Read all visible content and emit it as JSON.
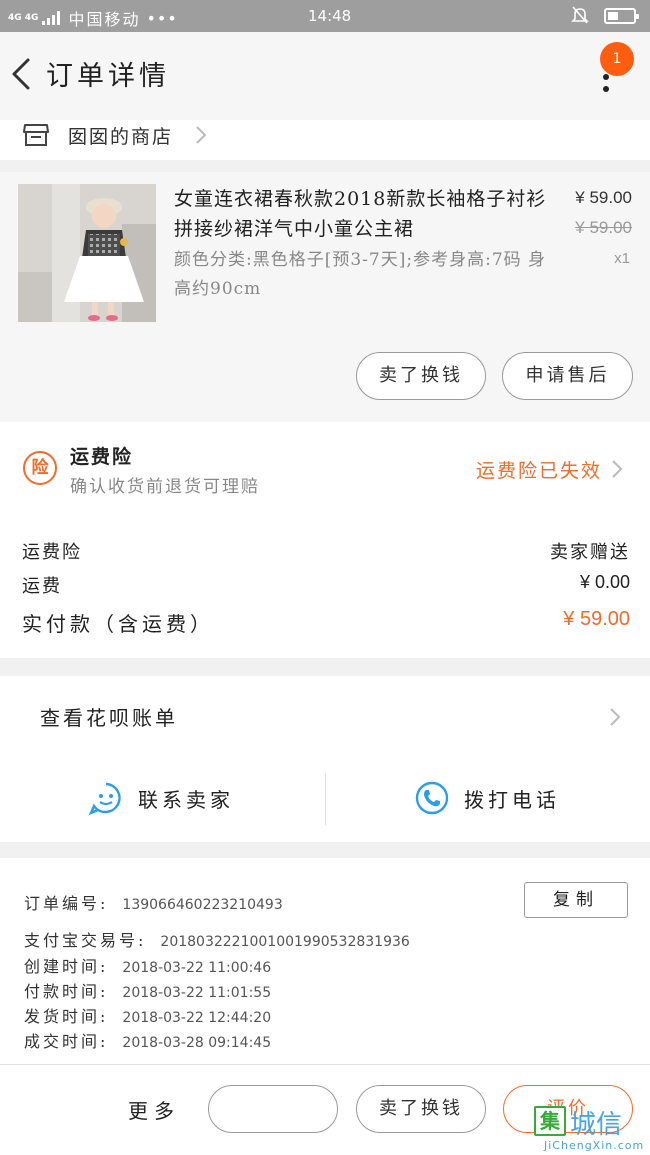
{
  "status_bar": {
    "signal": "4G 4G",
    "carrier": "中国移动",
    "dots": "•••",
    "time": "14:48",
    "icons": [
      "signal-bars-icon",
      "mute-bell-icon",
      "battery-icon"
    ]
  },
  "nav": {
    "title": "订单详情",
    "badge_count": "1",
    "icons": [
      "back-arrow-icon",
      "more-dots-icon"
    ]
  },
  "shop": {
    "name": "囡囡的商店",
    "icons": [
      "shop-icon",
      "chevron-right-icon"
    ]
  },
  "product": {
    "title": "女童连衣裙春秋款2018新款长袖格子衬衫拼接纱裙洋气中小童公主裙",
    "spec": "颜色分类:黑色格子[预3-7天];参考身高:7码 身高约90cm",
    "price": "¥ 59.00",
    "original_price": "¥ 59.00",
    "quantity": "x1",
    "buttons": [
      "卖了换钱",
      "申请售后"
    ]
  },
  "freight": {
    "title": "运费险",
    "subtitle": "确认收货前退货可理赔",
    "status": "运费险已失效",
    "status_color": "#f26b28",
    "rows": [
      {
        "label": "运费险",
        "value": "卖家赠送"
      },
      {
        "label": "运费",
        "value": "¥ 0.00"
      },
      {
        "label": "实付款（含运费）",
        "value": "¥ 59.00"
      }
    ]
  },
  "huabei": {
    "label": "查看花呗账单"
  },
  "contact": {
    "seller": "联系卖家",
    "call": "拨打电话",
    "icon_color": "#2d9de8"
  },
  "order_info": {
    "copy_label": "复制",
    "lines": [
      {
        "key": "订单编号:",
        "value": "139066460223210493"
      },
      {
        "key": "支付宝交易号:",
        "value": "2018032221001001990532831936"
      },
      {
        "key": "创建时间:",
        "value": "2018-03-22 11:00:46"
      },
      {
        "key": "付款时间:",
        "value": "2018-03-22 11:01:55"
      },
      {
        "key": "发货时间:",
        "value": "2018-03-22 12:44:20"
      },
      {
        "key": "成交时间:",
        "value": "2018-03-28 09:14:45"
      }
    ]
  },
  "bottom_bar": {
    "more": "更多",
    "blank_button": "",
    "sell_button": "卖了换钱",
    "review_button": "评价",
    "accent_color": "#f26b28"
  },
  "watermark": {
    "logo_glyph": "集",
    "text": "城信",
    "url": "JiChengXin.com"
  }
}
